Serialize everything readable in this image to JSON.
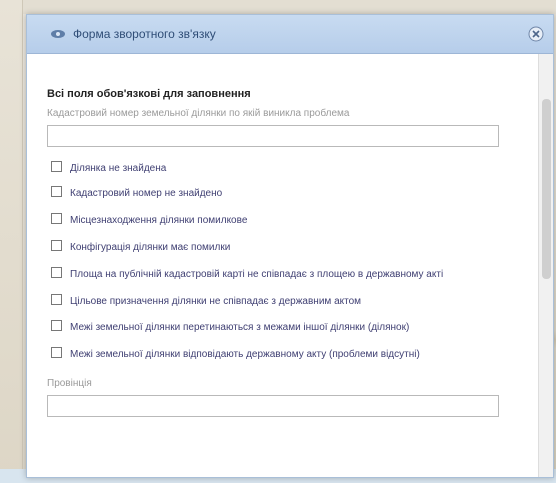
{
  "dialog": {
    "title": "Форма зворотного зв'язку",
    "required_note": "Всі поля обов'язкові для заповнення",
    "cadastral_label": "Кадастровий номер земельної ділянки по якій виникла проблема",
    "cadastral_value": "",
    "problems": [
      {
        "label": "Ділянка не знайдена",
        "checked": false
      },
      {
        "label": "Кадастровий номер не знайдено",
        "checked": false
      },
      {
        "label": "Місцезнаходження ділянки помилкове",
        "checked": false
      },
      {
        "label": "Конфігурація ділянки має помилки",
        "checked": false
      },
      {
        "label": "Площа на публічній кадастровій карті не співпадає з площею в державному акті",
        "checked": false
      },
      {
        "label": "Цільове призначення ділянки не співпадає з державним актом",
        "checked": false
      },
      {
        "label": "Межі земельної ділянки перетинаються з межами іншої ділянки (ділянок)",
        "checked": false
      },
      {
        "label": "Межі земельної ділянки відповідають державному акту (проблеми відсутні)",
        "checked": false
      }
    ],
    "region_label": "Провінція",
    "region_value": ""
  },
  "icons": {
    "header": "eye-icon",
    "close": "close-icon"
  },
  "colors": {
    "header_bg": "#bcd2ee",
    "title_text": "#2f4d77",
    "option_text": "#3f3f72"
  }
}
